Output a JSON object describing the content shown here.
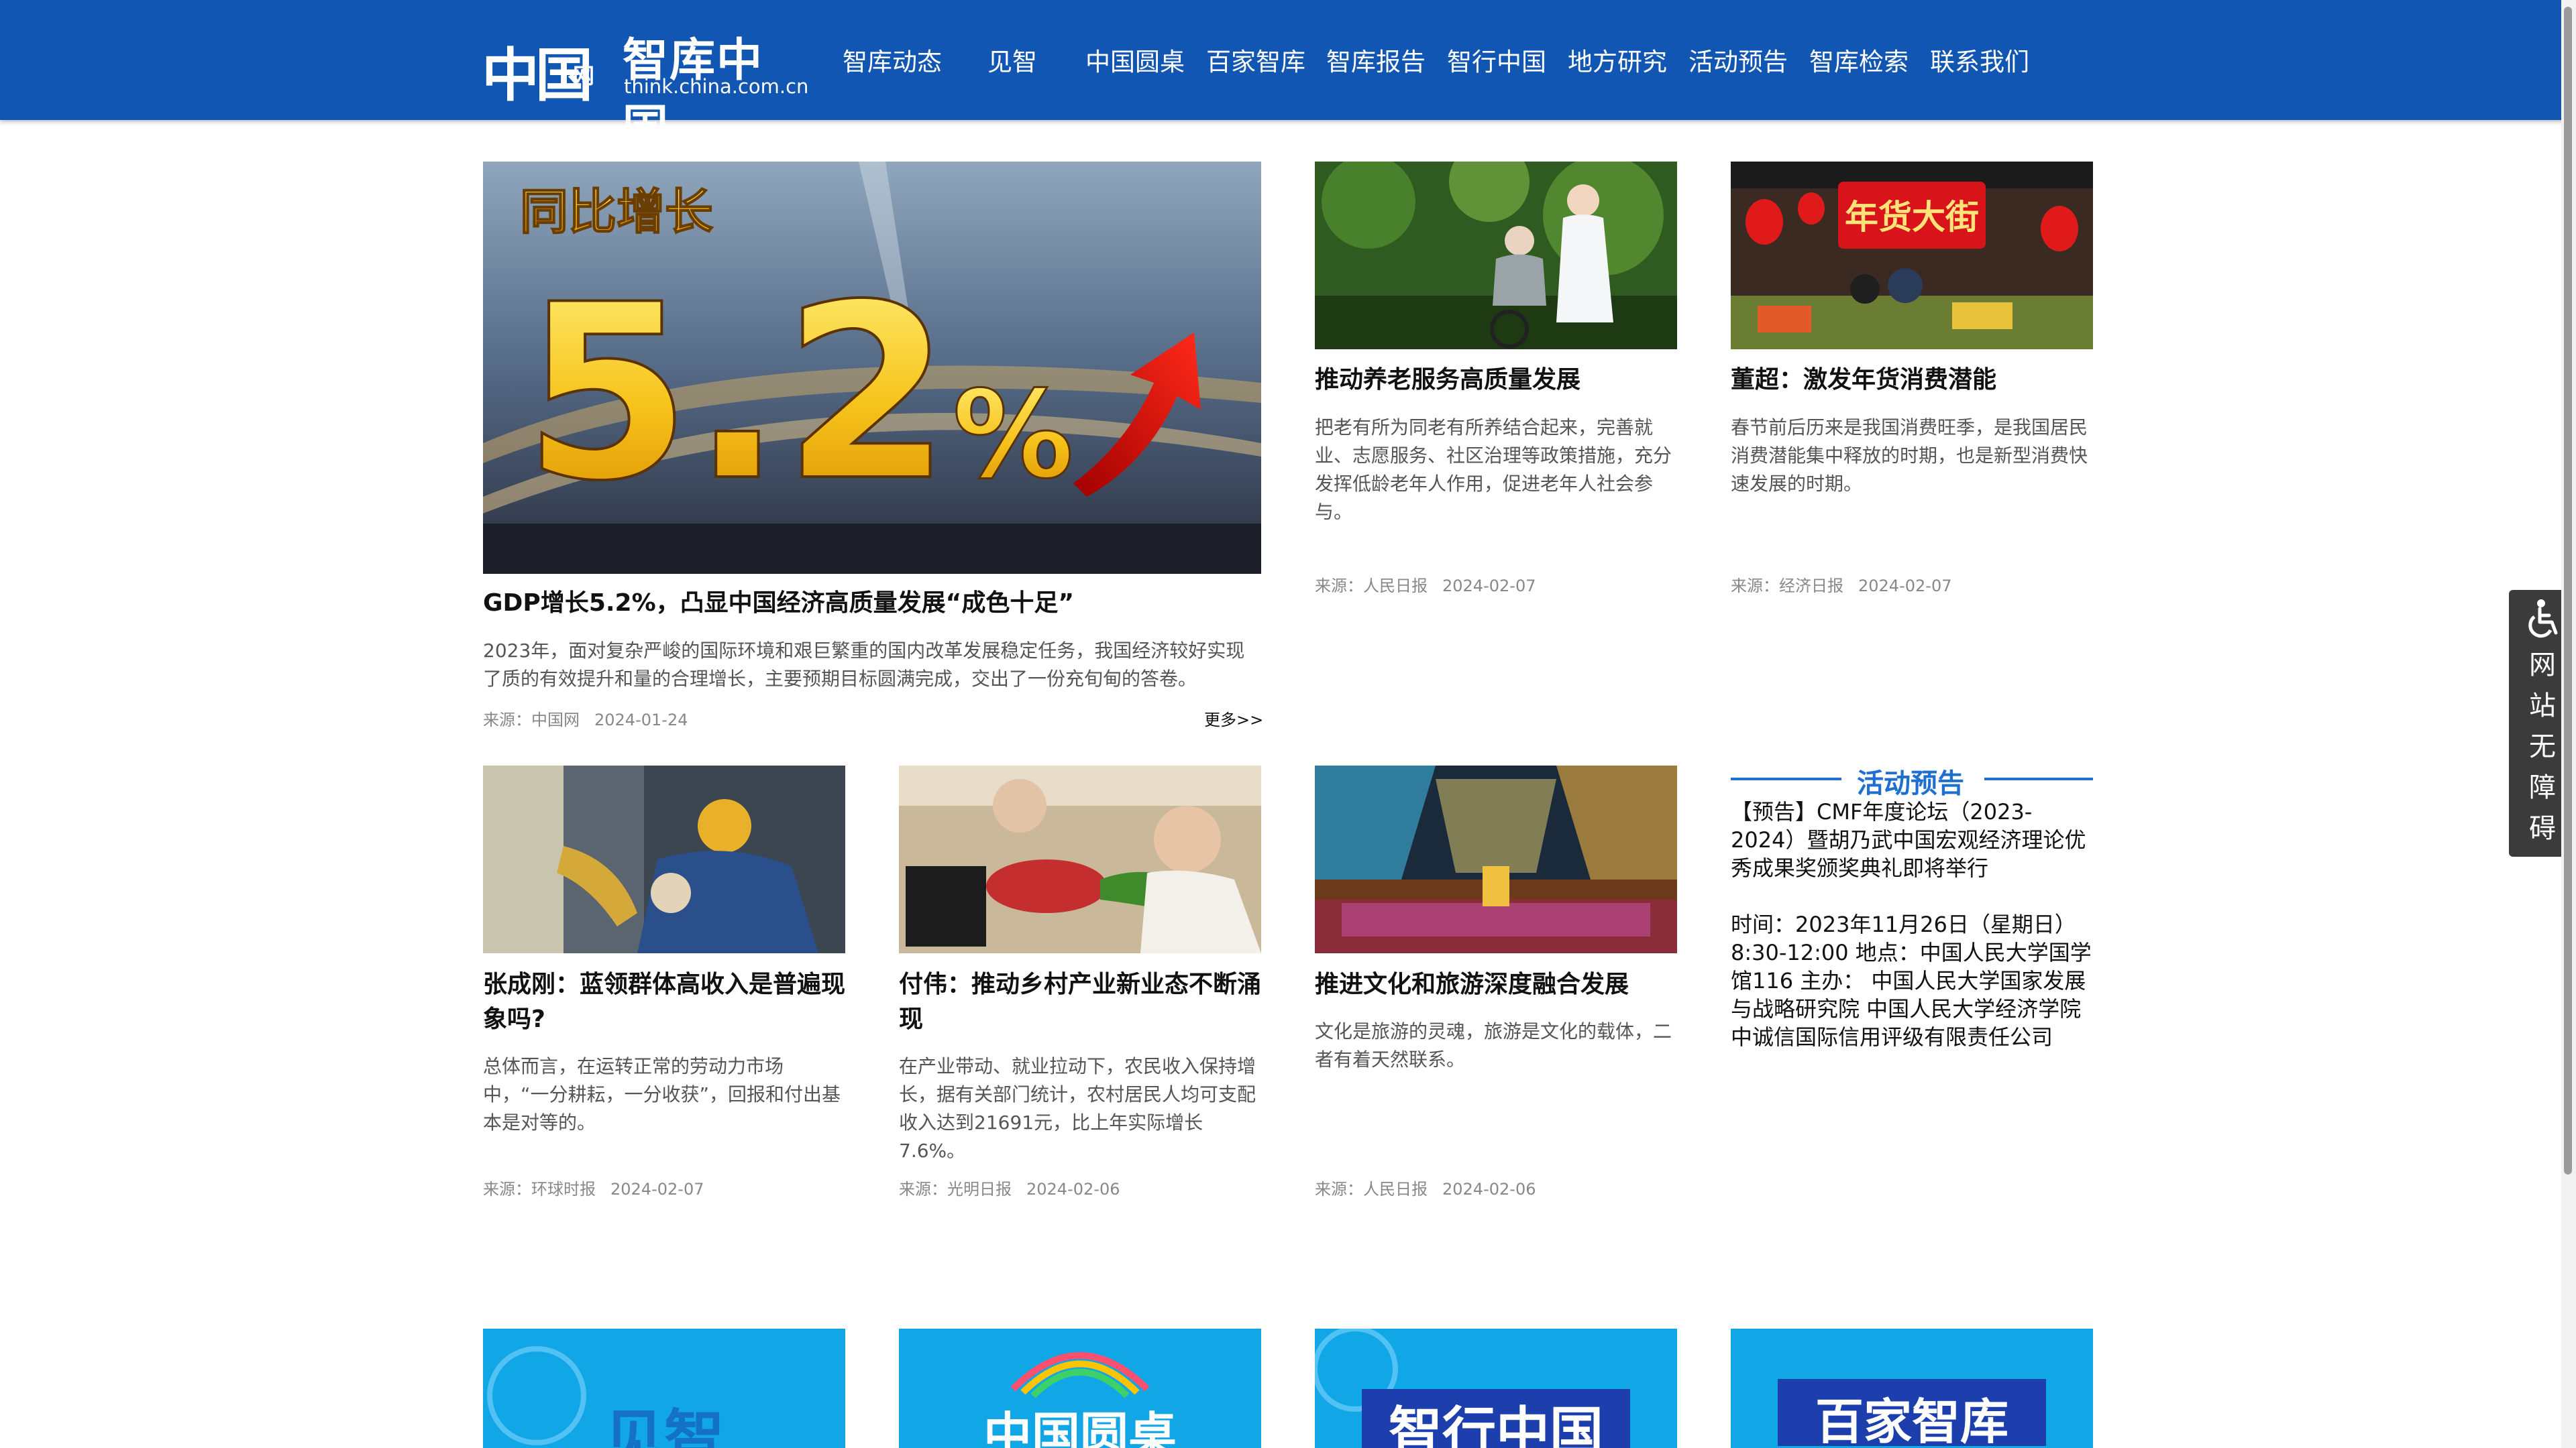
{
  "header": {
    "logo_mark": "中国",
    "logo_mark_sub": "网",
    "site_name": "智库中国",
    "site_url": "think.china.com.cn",
    "nav": [
      "智库动态",
      "见智",
      "中国圆桌",
      "百家智库",
      "智库报告",
      "智行中国",
      "地方研究",
      "活动预告",
      "智库检索",
      "联系我们"
    ]
  },
  "feature": {
    "image_text_top": "同比增长",
    "image_text_big": "5.2",
    "image_text_pct": "%",
    "title": "GDP增长5.2%，凸显中国经济高质量发展“成色十足”",
    "desc": "2023年，面对复杂严峻的国际环境和艰巨繁重的国内改革发展稳定任务，我国经济较好实现了质的有效提升和量的合理增长，主要预期目标圆满完成，交出了一份充旬甸的答卷。",
    "source": "来源：中国网",
    "date": "2024-01-24",
    "more": "更多>>"
  },
  "top_cards": [
    {
      "title": "推动养老服务高质量发展",
      "desc": "把老有所为同老有所养结合起来，完善就业、志愿服务、社区治理等政策措施，充分发挥低龄老年人作用，促进老年人社会参与。",
      "source": "来源：人民日报",
      "date": "2024-02-07"
    },
    {
      "image_sign": "年货大街",
      "title": "董超：激发年货消费潜能",
      "desc": "春节前后历来是我国消费旺季，是我国居民消费潜能集中释放的时期，也是新型消费快速发展的时期。",
      "source": "来源：经济日报",
      "date": "2024-02-07"
    }
  ],
  "bottom_cards": [
    {
      "title": "张成刚：蓝领群体高收入是普遍现象吗?",
      "desc": "总体而言，在运转正常的劳动力市场中，“一分耕耘，一分收获”，回报和付出基本是对等的。",
      "source": "来源：环球时报",
      "date": "2024-02-07"
    },
    {
      "title": "付伟：推动乡村产业新业态不断涌现",
      "desc": "在产业带动、就业拉动下，农民收入保持增长，据有关部门统计，农村居民人均可支配收入达到21691元，比上年实际增长7.6%。",
      "source": "来源：光明日报",
      "date": "2024-02-06"
    },
    {
      "title": "推进文化和旅游深度融合发展",
      "desc": "文化是旅游的灵魂，旅游是文化的载体，二者有着天然联系。",
      "source": "来源：人民日报",
      "date": "2024-02-06"
    }
  ],
  "activity": {
    "heading": "活动预告",
    "title": "【预告】CMF年度论坛（2023-2024）暨胡乃武中国宏观经济理论优秀成果奖颁奖典礼即将举行",
    "details": "时间：2023年11月26日（星期日）8:30-12:00 地点：中国人民大学国学馆116 主办： 中国人民大学国家发展与战略研究院 中国人民大学经济学院 中诚信国际信用评级有限责任公司"
  },
  "accessibility": {
    "icon": "wheelchair-icon",
    "label": [
      "网",
      "站",
      "无",
      "障",
      "碍"
    ]
  },
  "tiles": [
    "见智",
    "中国圆桌",
    "智行中国",
    "百家智库"
  ],
  "colors": {
    "header_bg": "#1256b4",
    "accent": "#1f6fd0",
    "tile_bg": "#11a6e6"
  }
}
